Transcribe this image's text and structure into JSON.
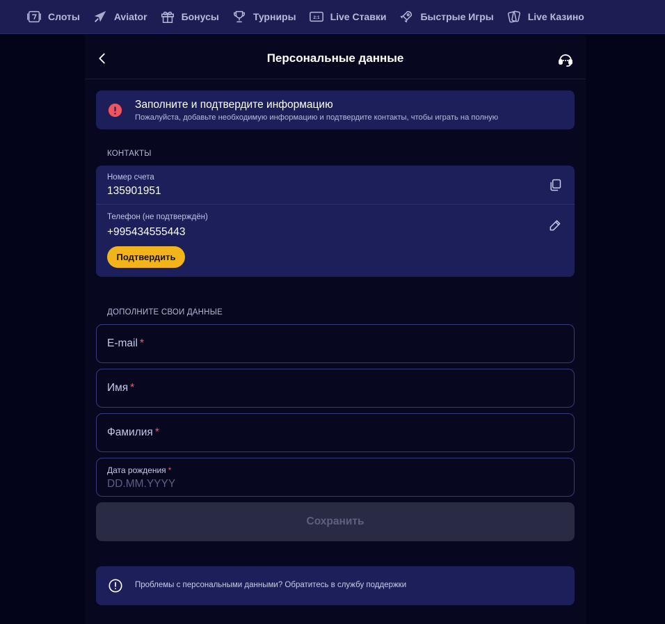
{
  "nav": {
    "items": [
      {
        "label": "Слоты",
        "icon": "slot-seven-icon"
      },
      {
        "label": "Aviator",
        "icon": "plane-icon"
      },
      {
        "label": "Бонусы",
        "icon": "gift-icon"
      },
      {
        "label": "Турниры",
        "icon": "trophy-icon"
      },
      {
        "label": "Live Ставки",
        "icon": "score-board-icon"
      },
      {
        "label": "Быстрые Игры",
        "icon": "rocket-icon"
      },
      {
        "label": "Live Казино",
        "icon": "cards-icon"
      }
    ]
  },
  "header": {
    "title": "Персональные данные"
  },
  "alert": {
    "title": "Заполните и подтвердите информацию",
    "text": "Пожалуйста, добавьте необходимую информацию и подтвердите контакты, чтобы играть на полную"
  },
  "contacts": {
    "section_label": "КОНТАКТЫ",
    "account_label": "Номер счета",
    "account_value": "135901951",
    "phone_label": "Телефон (не подтверждён)",
    "phone_value": "+995434555443",
    "confirm_label": "Подтвердить"
  },
  "profile": {
    "section_label": "ДОПОЛНИТЕ СВОИ ДАННЫЕ",
    "email_label": "E-mail",
    "first_name_label": "Имя",
    "last_name_label": "Фамилия",
    "birth_label": "Дата рождения",
    "birth_placeholder": "DD.MM.YYYY",
    "required_mark": "*"
  },
  "save_label": "Сохранить",
  "support_note": "Проблемы с персональными данными? Обратитесь в службу поддержки",
  "colors": {
    "nav_bg": "#1c1d52",
    "card_bg": "#1d1f5a",
    "accent_yellow": "#f2b41b",
    "alert_red": "#f0545c",
    "required_red": "#ff4f5f"
  }
}
